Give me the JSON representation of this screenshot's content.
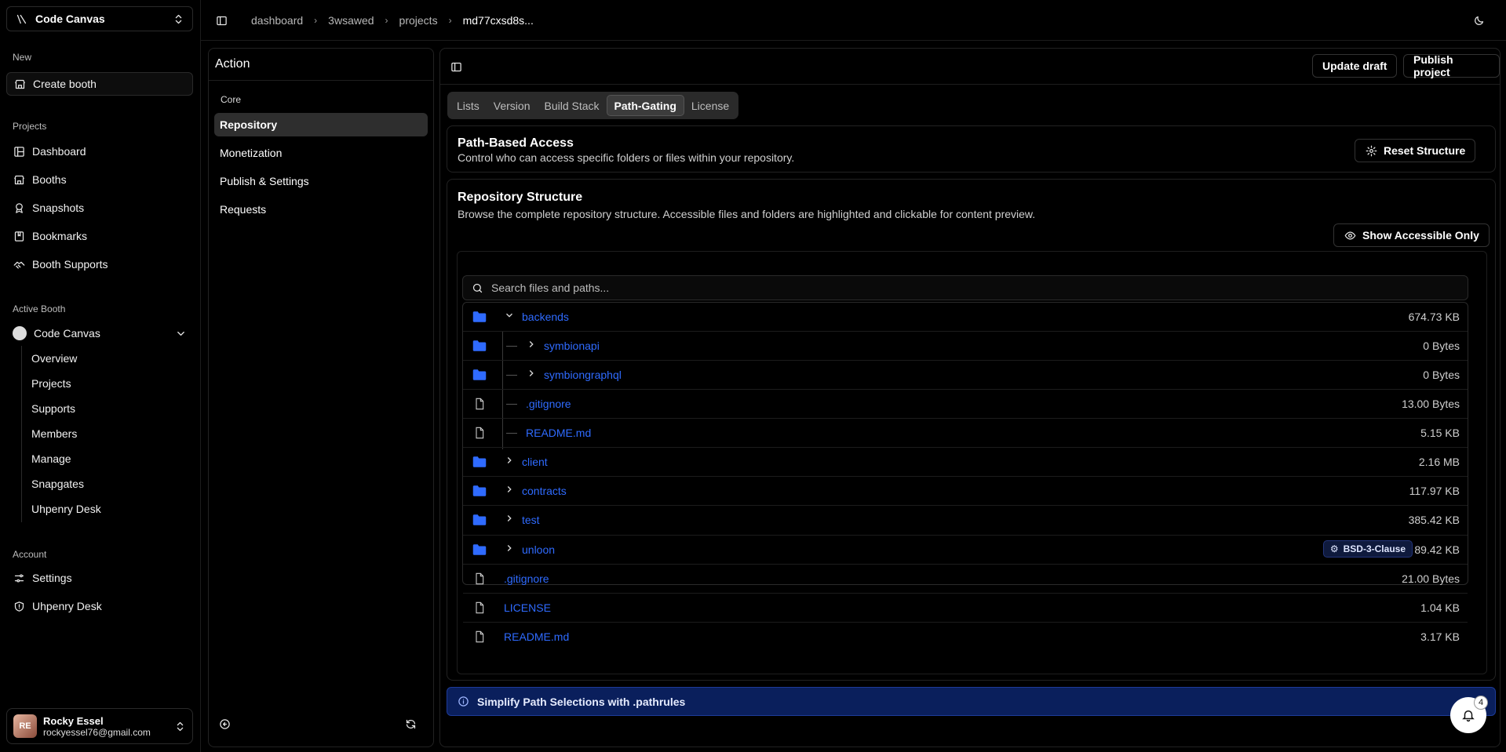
{
  "workspace": {
    "name": "Code Canvas"
  },
  "sidebar": {
    "new_label": "New",
    "create_booth": "Create booth",
    "projects_label": "Projects",
    "projects_items": [
      "Dashboard",
      "Booths",
      "Snapshots",
      "Bookmarks",
      "Booth Supports"
    ],
    "active_booth_label": "Active Booth",
    "active_booth_name": "Code Canvas",
    "booth_sub_items": [
      "Overview",
      "Projects",
      "Supports",
      "Members",
      "Manage",
      "Snapgates",
      "Uhpenry Desk"
    ],
    "account_label": "Account",
    "account_items": [
      "Settings",
      "Uhpenry Desk"
    ],
    "user": {
      "name": "Rocky Essel",
      "email": "rockyessel76@gmail.com"
    }
  },
  "breadcrumb": [
    "dashboard",
    "3wsawed",
    "projects",
    "md77cxsd8s..."
  ],
  "action": {
    "title": "Action",
    "section": "Core",
    "items": [
      "Repository",
      "Monetization",
      "Publish & Settings",
      "Requests"
    ],
    "active_index": 0
  },
  "main": {
    "update_draft": "Update draft",
    "publish_project": "Publish project",
    "tabs": [
      "Lists",
      "Version",
      "Build Stack",
      "Path-Gating",
      "License"
    ],
    "active_tab": "Path-Gating",
    "path_access": {
      "title": "Path-Based Access",
      "desc": "Control who can access specific folders or files within your repository.",
      "reset_button": "Reset Structure"
    },
    "repo": {
      "title": "Repository Structure",
      "desc": "Browse the complete repository structure. Accessible files and folders are highlighted and clickable for content preview.",
      "show_accessible": "Show Accessible Only",
      "search_placeholder": "Search files and paths...",
      "rows": [
        {
          "name": "backends",
          "size": "674.73 KB",
          "type": "folder",
          "expanded": true,
          "depth": 0
        },
        {
          "name": "symbionapi",
          "size": "0 Bytes",
          "type": "folder",
          "expanded": false,
          "depth": 1
        },
        {
          "name": "symbiongraphql",
          "size": "0 Bytes",
          "type": "folder",
          "expanded": false,
          "depth": 1
        },
        {
          "name": ".gitignore",
          "size": "13.00 Bytes",
          "type": "file",
          "depth": 1
        },
        {
          "name": "README.md",
          "size": "5.15 KB",
          "type": "file",
          "depth": 1
        },
        {
          "name": "client",
          "size": "2.16 MB",
          "type": "folder",
          "expanded": false,
          "depth": 0
        },
        {
          "name": "contracts",
          "size": "117.97 KB",
          "type": "folder",
          "expanded": false,
          "depth": 0
        },
        {
          "name": "test",
          "size": "385.42 KB",
          "type": "folder",
          "expanded": false,
          "depth": 0
        },
        {
          "name": "unloon",
          "size": "89.42 KB",
          "type": "folder",
          "expanded": false,
          "depth": 0,
          "badge": "BSD-3-Clause"
        },
        {
          "name": ".gitignore",
          "size": "21.00 Bytes",
          "type": "file",
          "depth": 0
        },
        {
          "name": "LICENSE",
          "size": "1.04 KB",
          "type": "file",
          "depth": 0
        },
        {
          "name": "README.md",
          "size": "3.17 KB",
          "type": "file",
          "depth": 0
        }
      ]
    },
    "info_bar": "Simplify Path Selections with .pathrules"
  },
  "notifications": {
    "count": "4"
  },
  "colors": {
    "accent_link": "#2f6bff",
    "folder": "#2f6bff",
    "info_bg": "#0a1f5c",
    "background": "#000000"
  }
}
